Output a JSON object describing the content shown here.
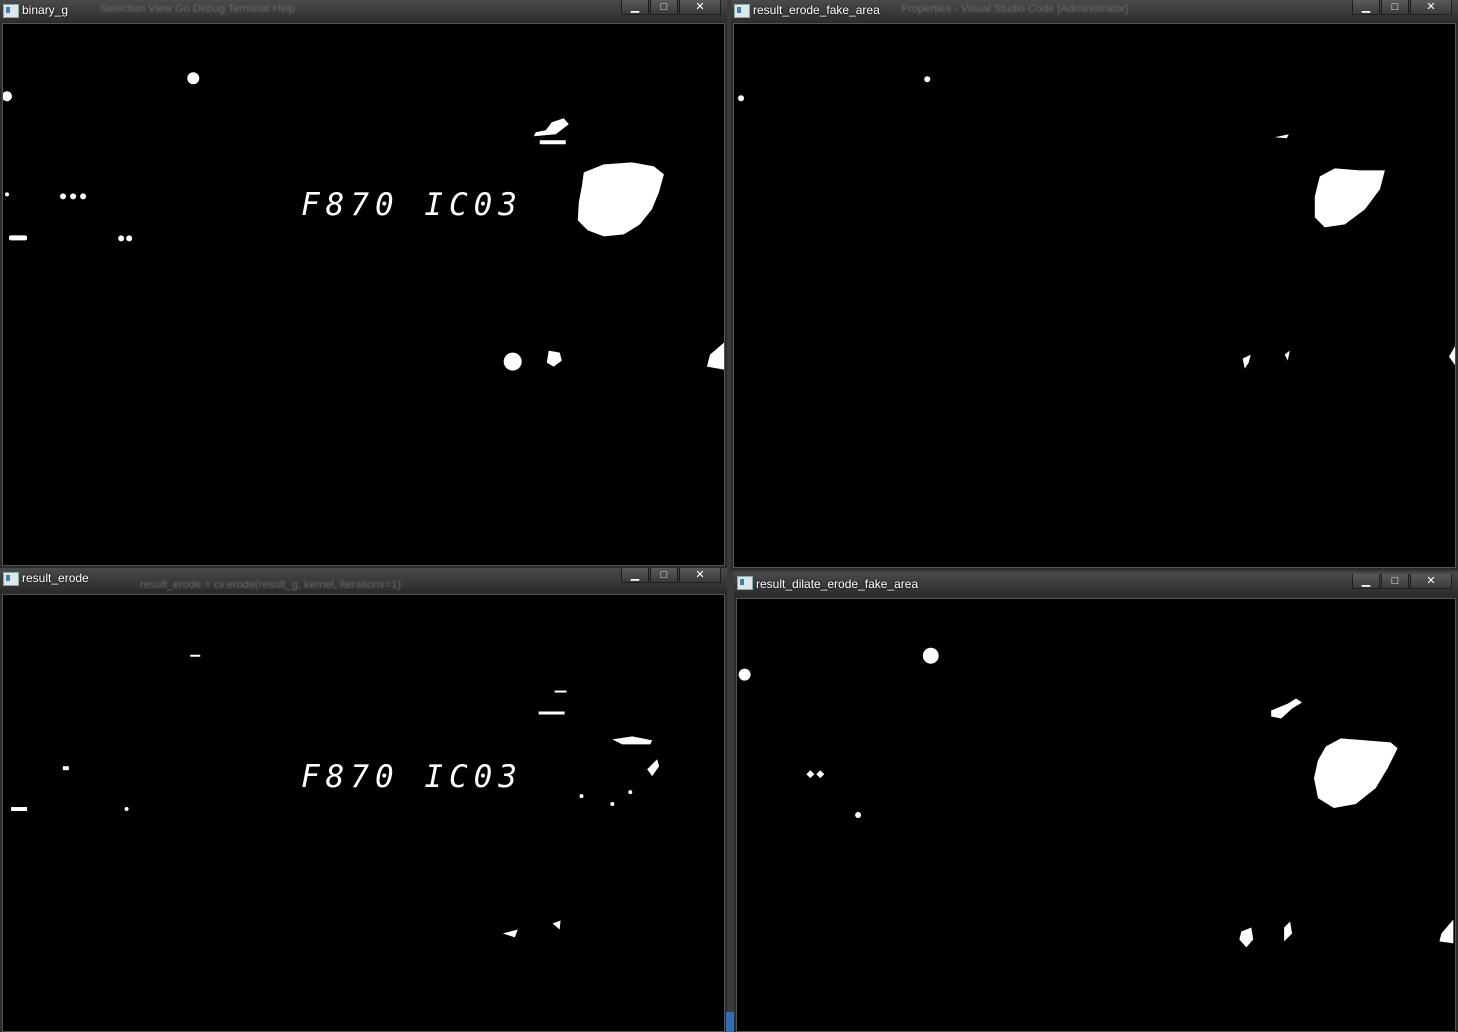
{
  "windows": [
    {
      "id": "binary_g",
      "title": "binary_g",
      "ghost": "Selection   View   Go   Debug   Terminal   Help",
      "digits": "F870 IC03"
    },
    {
      "id": "result_erode_fake_area",
      "title": "result_erode_fake_area",
      "ghost": "Properties - Visual Studio Code [Administrator]",
      "digits": ""
    },
    {
      "id": "result_erode",
      "title": "result_erode",
      "ghost": "result_erode = cv.erode(result_g, kernel, iterations=1)",
      "digits": "F870 IC03"
    },
    {
      "id": "result_dilate_erode_fake_area",
      "title": "result_dilate_erode_fake_area",
      "ghost": "",
      "digits": ""
    }
  ],
  "controls": {
    "minimize": "▁",
    "maximize": "□",
    "close": "✕"
  },
  "icons": {
    "app": "opencv-window-icon",
    "minimize": "minimize-icon",
    "maximize": "maximize-icon",
    "close": "close-icon"
  }
}
